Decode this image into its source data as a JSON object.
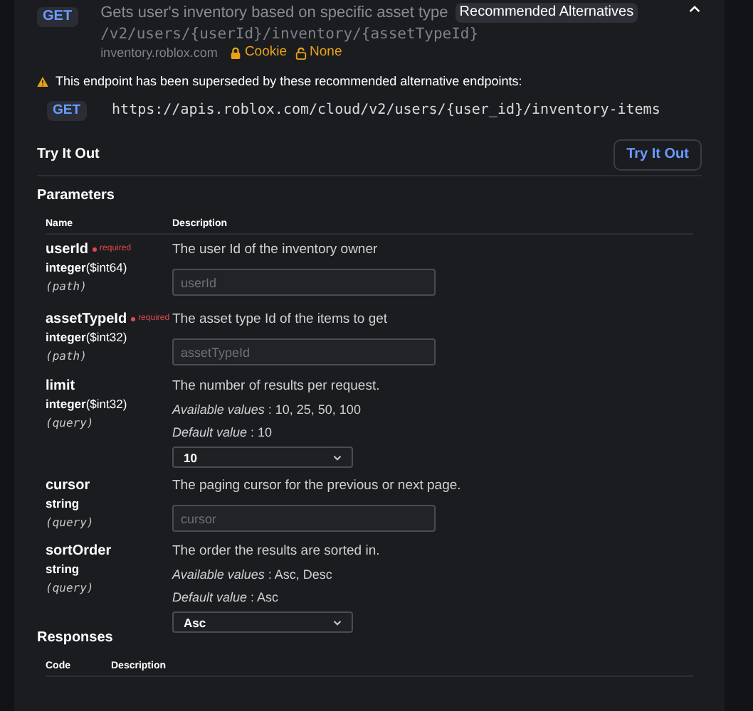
{
  "operation": {
    "method": "GET",
    "summary": "Gets user's inventory based on specific asset type",
    "badge": "Recommended Alternatives",
    "path": "/v2/users/{userId}/inventory/{assetTypeId}",
    "host": "inventory.roblox.com",
    "auth": [
      {
        "label": "Cookie"
      },
      {
        "label": "None"
      }
    ],
    "expanded": true
  },
  "notice": {
    "text": "This endpoint has been superseded by these recommended alternative endpoints:",
    "alternatives": [
      {
        "method": "GET",
        "url": "https://apis.roblox.com/cloud/v2/users/{user_id}/inventory-items"
      }
    ]
  },
  "try_it_out": {
    "title": "Try It Out",
    "button": "Try It Out"
  },
  "parameters": {
    "title": "Parameters",
    "columns": [
      "Name",
      "Description"
    ],
    "rows": [
      {
        "name": "userId",
        "required": true,
        "required_label": "required",
        "type": "integer",
        "format": "($int64)",
        "location": "(path)",
        "description": "The user Id of the inventory owner",
        "input": {
          "kind": "text",
          "placeholder": "userId"
        }
      },
      {
        "name": "assetTypeId",
        "required": true,
        "required_label": "required",
        "type": "integer",
        "format": "($int32)",
        "location": "(path)",
        "description": "The asset type Id of the items to get",
        "input": {
          "kind": "text",
          "placeholder": "assetTypeId"
        }
      },
      {
        "name": "limit",
        "required": false,
        "type": "integer",
        "format": "($int32)",
        "location": "(query)",
        "description": "The number of results per request.",
        "available": "*Available values* : 10, 25, 50, 100",
        "default": "*Default value* : 10",
        "input": {
          "kind": "select",
          "value": "10"
        }
      },
      {
        "name": "cursor",
        "required": false,
        "type": "string",
        "location": "(query)",
        "description": "The paging cursor for the previous or next page.",
        "input": {
          "kind": "text",
          "placeholder": "cursor"
        }
      },
      {
        "name": "sortOrder",
        "required": false,
        "type": "string",
        "location": "(query)",
        "description": "The order the results are sorted in.",
        "available": "*Available values* : Asc, Desc",
        "default": "*Default value* : Asc",
        "input": {
          "kind": "select",
          "value": "Asc"
        }
      }
    ]
  },
  "responses": {
    "title": "Responses",
    "columns": [
      "Code",
      "Description"
    ]
  }
}
